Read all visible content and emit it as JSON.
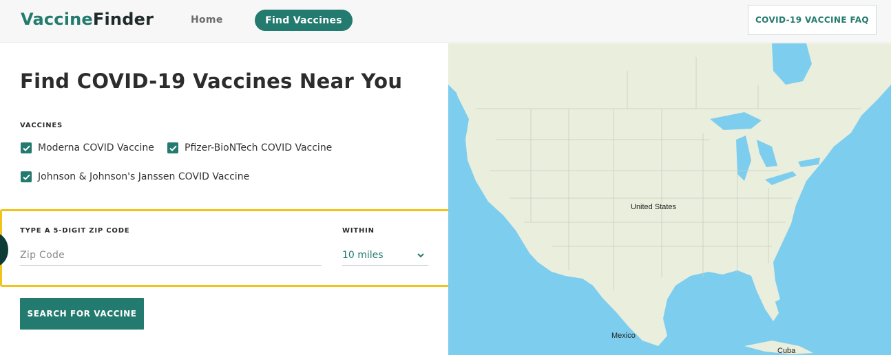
{
  "header": {
    "logo_part1": "Vaccine",
    "logo_part2": "Finder",
    "nav_home": "Home",
    "nav_find": "Find Vaccines",
    "faq_button": "COVID-19 VACCINE FAQ"
  },
  "main": {
    "title": "Find COVID-19 Vaccines Near You",
    "vaccines_label": "VACCINES",
    "vaccines": [
      {
        "label": "Moderna COVID Vaccine",
        "checked": true
      },
      {
        "label": "Pfizer-BioNTech COVID Vaccine",
        "checked": true
      },
      {
        "label": "Johnson & Johnson's Janssen COVID Vaccine",
        "checked": true
      }
    ],
    "zip_label": "TYPE A 5-DIGIT ZIP CODE",
    "zip_placeholder": "Zip Code",
    "zip_value": "",
    "within_label": "WITHIN",
    "within_selected": "10 miles",
    "search_button": "SEARCH FOR VACCINE"
  },
  "map": {
    "labels": {
      "us": "United States",
      "mexico": "Mexico",
      "cuba": "Cuba"
    }
  },
  "colors": {
    "brand": "#237a6e",
    "highlight": "#f0c419",
    "water": "#7dcdef",
    "land": "#e9eedd"
  }
}
